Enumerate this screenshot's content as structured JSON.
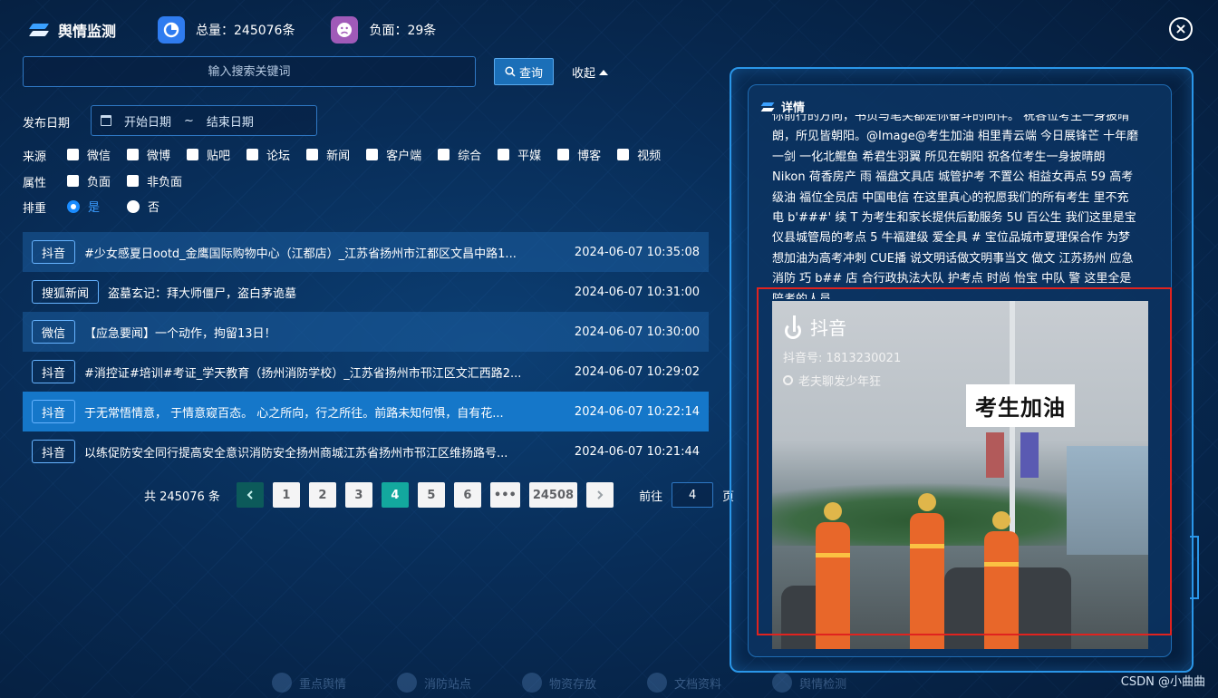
{
  "header": {
    "title": "舆情监测",
    "total_label": "总量：245076条",
    "negative_label": "负面：29条"
  },
  "search": {
    "placeholder": "输入搜索关键词",
    "query_label": "查询",
    "collapse_label": "收起"
  },
  "filters": {
    "date_label": "发布日期",
    "date_start": "开始日期",
    "date_sep": "~",
    "date_end": "结束日期",
    "source_label": "来源",
    "sources": [
      "微信",
      "微博",
      "贴吧",
      "论坛",
      "新闻",
      "客户端",
      "综合",
      "平媒",
      "博客",
      "视频"
    ],
    "attr_label": "属性",
    "attrs": [
      "负面",
      "非负面"
    ],
    "dedup_label": "排重",
    "dedup_options": [
      "是",
      "否"
    ],
    "dedup_selected": "是"
  },
  "list": {
    "rows": [
      {
        "tag": "抖音",
        "title": "#少女感夏日ootd_金鹰国际购物中心（江都店）_江苏省扬州市江都区文昌中路1...",
        "time": "2024-06-07 10:35:08"
      },
      {
        "tag": "搜狐新闻",
        "title": "盗墓玄记：拜大师僵尸，盗白茅诡墓",
        "time": "2024-06-07 10:31:00"
      },
      {
        "tag": "微信",
        "title": "【应急要闻】一个动作，拘留13日！",
        "time": "2024-06-07 10:30:00"
      },
      {
        "tag": "抖音",
        "title": "#消控证#培训#考证_学天教育（扬州消防学校）_江苏省扬州市邗江区文汇西路2...",
        "time": "2024-06-07 10:29:02"
      },
      {
        "tag": "抖音",
        "title": "于无常悟情意， 于情意窥百态。 心之所向，行之所往。前路未知何惧，自有花...",
        "time": "2024-06-07 10:22:14"
      },
      {
        "tag": "抖音",
        "title": "以练促防安全同行提高安全意识消防安全扬州商城江苏省扬州市邗江区维扬路号...",
        "time": "2024-06-07 10:21:44"
      }
    ],
    "active_index": 4
  },
  "pagination": {
    "total_text": "共 245076 条",
    "pages": [
      "1",
      "2",
      "3",
      "4",
      "5",
      "6",
      "•••",
      "24508"
    ],
    "current": "4",
    "goto_label": "前往",
    "goto_value": "4",
    "page_unit": "页"
  },
  "detail": {
    "title": "详情",
    "text": "你前行的方向，书页与笔尖都是你奋斗的同伴。 祝各位考生一身披晴朗，所见皆朝阳。@Image@考生加油 相里青云端 今日展锋芒 十年磨一剑 一化北鲲鱼 希君生羽翼 所见在朝阳 祝各位考生一身披晴朗 Nikon 荷香房产 雨 福盘文具店 城管护考 不置公 相益女再点 59 高考级油 福位全员店 中国电信 在这里真心的祝愿我们的所有考生 里不充电 b'###' 续 T 为考生和家长提供后勤服务 5U 百公生 我们这里是宝仪县城管局的考点 5 牛福建级 爱全具 # 宝位品城市夏理保合作 为梦想加油为高考冲刺 CUE播 说文明话做文明事当文 做文 江苏扬州 应急消防 巧 b## 店 合行政执法大队 护考点 时尚 怡宝 中队 警 这里全是陪考的人员",
    "media": {
      "app_name": "抖音",
      "account": "抖音号: 1813230021",
      "nickname": "老夫聊发少年狂",
      "caption": "考生加油"
    }
  },
  "footer_nav": [
    "重点舆情",
    "消防站点",
    "物资存放",
    "文档资料",
    "舆情检测"
  ],
  "watermark": "CSDN @小曲曲",
  "colors": {
    "accent": "#1577c9",
    "current_page": "#13a89e",
    "highlight_box": "#e0231f"
  }
}
